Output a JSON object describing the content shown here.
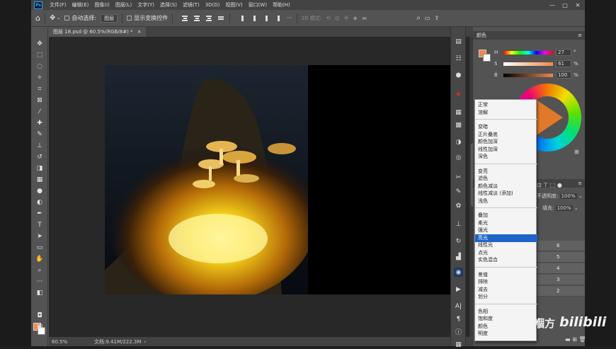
{
  "menu": {
    "logo": "Ps",
    "items": [
      "文件(F)",
      "编辑(E)",
      "图像(I)",
      "图层(L)",
      "文字(Y)",
      "选择(S)",
      "滤镜(T)",
      "3D(D)",
      "视图(V)",
      "窗口(W)",
      "帮助(H)"
    ]
  },
  "window_controls": {
    "minimize": "—",
    "maximize": "□",
    "close": "✕"
  },
  "options": {
    "auto_select_label": "自动选择:",
    "auto_select_value": "图层",
    "show_transform_label": "显示变换控件",
    "mode_3d_label": "3D 模式:"
  },
  "document": {
    "tab_title": "图层 18.psd @ 60.5%(RGB/8#) *",
    "tab_close": "×",
    "zoom": "60.5%",
    "file_info": "文档:9.41M/222.3M"
  },
  "color_panel": {
    "title": "颜色",
    "h_label": "H",
    "h_value": "27",
    "s_label": "S",
    "s_value": "61",
    "b_label": "B",
    "b_value": "100",
    "h_unit": "°",
    "pct": "%",
    "foreground": "#f0874b",
    "background": "#ffffff"
  },
  "layers_panel": {
    "opacity_label": "不透明度:",
    "opacity_value": "100%",
    "fill_label": "填充:",
    "fill_value": "100%",
    "rows": [
      "6",
      "5",
      "4",
      "3",
      "2"
    ]
  },
  "blend_menu": {
    "groups": [
      [
        "正常",
        "溶解"
      ],
      [
        "变暗",
        "正片叠底",
        "颜色加深",
        "线性加深",
        "深色"
      ],
      [
        "变亮",
        "滤色",
        "颜色减淡",
        "线性减淡 (添加)",
        "浅色"
      ],
      [
        "叠加",
        "柔光",
        "强光",
        "亮光",
        "线性光",
        "点光",
        "实色混合"
      ],
      [
        "差值",
        "排除",
        "减去",
        "划分"
      ],
      [
        "色相",
        "饱和度",
        "颜色",
        "明度"
      ]
    ],
    "highlighted": "亮光"
  },
  "watermark": {
    "brand": "嗰方",
    "bilibili": "bilibili"
  },
  "accent": "#1f63c9"
}
